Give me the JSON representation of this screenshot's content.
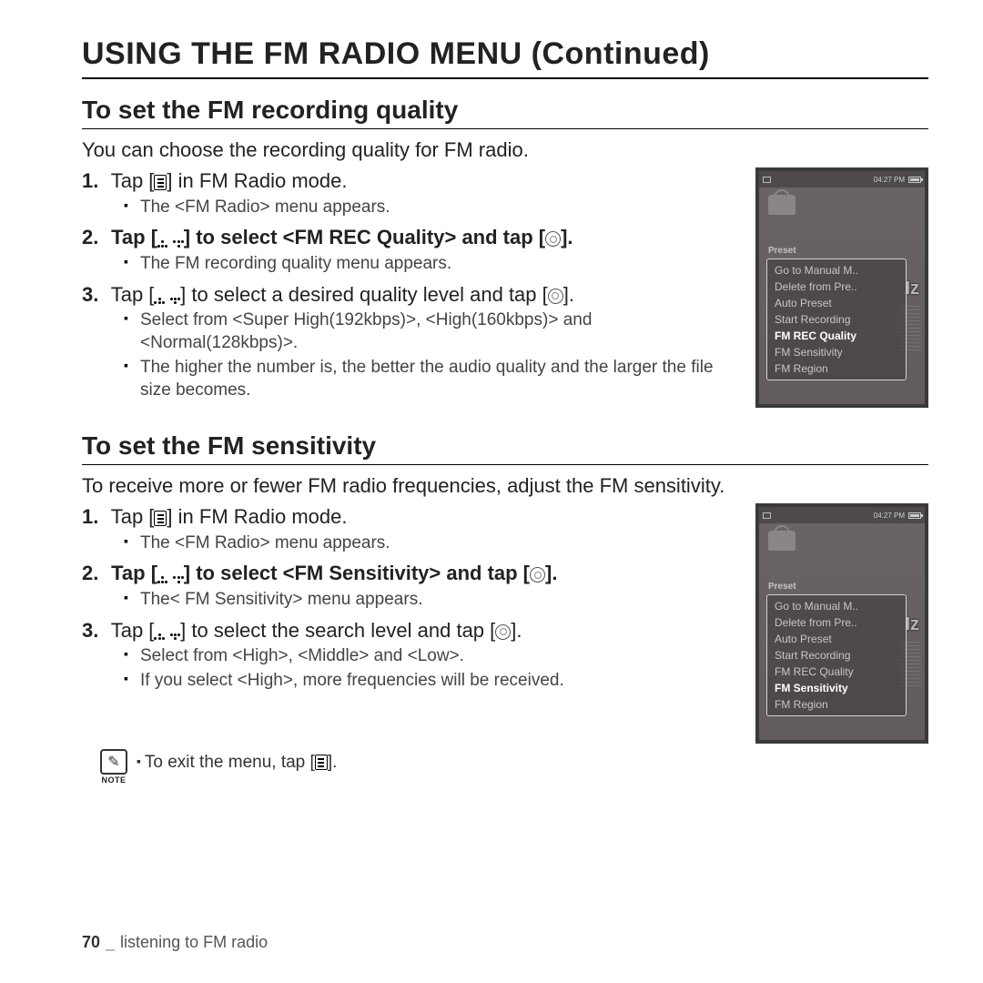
{
  "page": {
    "title": "USING THE FM RADIO MENU (Continued)",
    "footer_page": "70",
    "footer_chapter": "listening to FM radio"
  },
  "icons": {
    "menu_alt": "menu button",
    "updown_alt": "up/down buttons",
    "ok_alt": "OK button"
  },
  "device": {
    "time": "04:27 PM",
    "preset_label": "Preset",
    "hz": "Iz",
    "menu_items": [
      "Go to Manual M..",
      "Delete from Pre..",
      "Auto Preset",
      "Start Recording",
      "FM REC Quality",
      "FM Sensitivity",
      "FM Region"
    ],
    "highlight_a": "FM REC Quality",
    "highlight_b": "FM Sensitivity"
  },
  "section_a": {
    "heading": "To set the FM recording quality",
    "intro": "You can choose the recording quality for FM radio.",
    "step1_a": "Tap [",
    "step1_b": "] in FM Radio mode.",
    "step1_sub1": "The <FM Radio> menu appears.",
    "step2_a": "Tap [",
    "step2_b": "] to select ",
    "step2_bold": "<FM REC Quality>",
    "step2_c": " and tap [",
    "step2_d": "].",
    "step2_sub1": "The FM recording quality menu appears.",
    "step3_a": "Tap [",
    "step3_b": "] to select a desired quality level and tap [",
    "step3_c": "].",
    "step3_sub1": "Select from <Super High(192kbps)>, <High(160kbps)> and <Normal(128kbps)>.",
    "step3_sub2": "The higher the number is, the better the audio quality and the larger the file size becomes."
  },
  "section_b": {
    "heading": "To set the FM sensitivity",
    "intro": "To receive more or fewer FM radio frequencies, adjust the FM sensitivity.",
    "step1_a": "Tap [",
    "step1_b": "] in FM Radio mode.",
    "step1_sub1": "The <FM Radio> menu appears.",
    "step2_a": "Tap [",
    "step2_b": "] to select ",
    "step2_bold": "<FM Sensitivity>",
    "step2_c": " and tap [",
    "step2_d": "].",
    "step2_sub1": "The< FM Sensitivity> menu appears.",
    "step3_a": "Tap [",
    "step3_b": "] to select the search level and tap [",
    "step3_c": "].",
    "step3_sub1": "Select from <High>, <Middle> and <Low>.",
    "step3_sub2": "If you select <High>, more frequencies will be received."
  },
  "note": {
    "label": "NOTE",
    "text_a": "To exit the menu, tap [",
    "text_b": "]."
  }
}
